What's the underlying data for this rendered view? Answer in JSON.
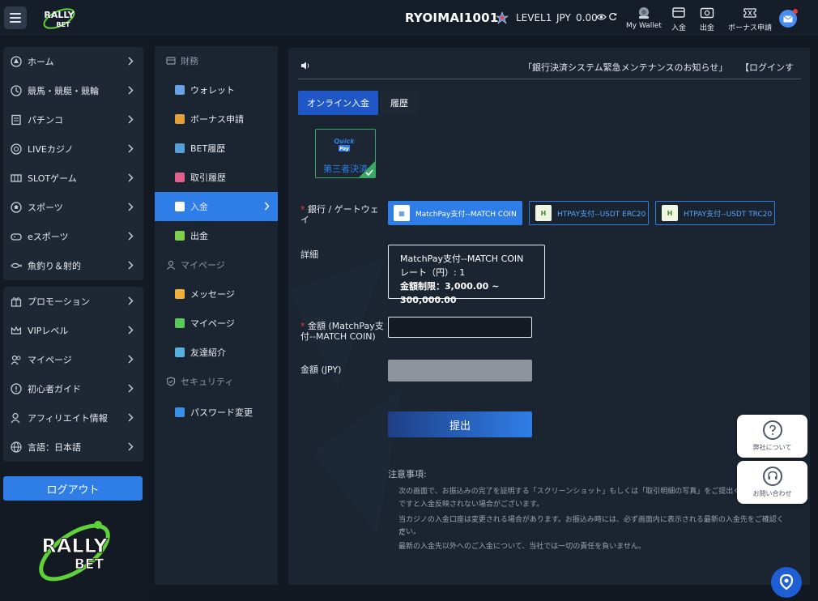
{
  "header": {
    "username": "RYOIMAI1001",
    "level": "LEVEL1",
    "currency": "JPY",
    "balance": "0.00",
    "buttons": [
      {
        "label": "My Wallet",
        "icon": "wallet-icon"
      },
      {
        "label": "入金",
        "icon": "deposit-icon"
      },
      {
        "label": "出金",
        "icon": "withdraw-icon"
      },
      {
        "label": "ボーナス申請",
        "icon": "bonus-ticket-icon"
      }
    ]
  },
  "sidebar": {
    "group1": [
      {
        "label": "ホーム",
        "icon": "home-icon"
      },
      {
        "label": "競馬・競艇・競輪",
        "icon": "race-icon"
      },
      {
        "label": "パチンコ",
        "icon": "pachinko-icon"
      },
      {
        "label": "LIVEカジノ",
        "icon": "live-casino-icon"
      },
      {
        "label": "SLOTゲーム",
        "icon": "slot-icon"
      },
      {
        "label": "スポーツ",
        "icon": "sports-icon"
      },
      {
        "label": "eスポーツ",
        "icon": "esports-icon"
      },
      {
        "label": "魚釣り＆射的",
        "icon": "fishing-icon"
      }
    ],
    "group2": [
      {
        "label": "プロモーション",
        "icon": "gift-icon"
      },
      {
        "label": "VIPレベル",
        "icon": "crown-icon"
      },
      {
        "label": "マイページ",
        "icon": "users-icon"
      },
      {
        "label": "初心者ガイド",
        "icon": "info-icon"
      },
      {
        "label": "アフィリエイト情報",
        "icon": "affiliate-icon"
      },
      {
        "label": "言語：日本語",
        "icon": "globe-icon"
      }
    ],
    "logout_label": "ログアウト"
  },
  "subnav": {
    "section_finance": "財務",
    "finance_items": [
      {
        "label": "ウォレット",
        "color": "#6aa0e6"
      },
      {
        "label": "ボーナス申請",
        "color": "#e3a13a"
      },
      {
        "label": "BET履歴",
        "color": "#55a0d8"
      },
      {
        "label": "取引履歴",
        "color": "#e35f8c"
      },
      {
        "label": "入金",
        "color": "#ffffff"
      },
      {
        "label": "出金",
        "color": "#7fcf4a"
      }
    ],
    "section_mypage": "マイページ",
    "mypage_items": [
      {
        "label": "メッセージ",
        "color": "#f0b23a"
      },
      {
        "label": "マイページ",
        "color": "#5cc85c"
      },
      {
        "label": "友達紹介",
        "color": "#58b0e0"
      }
    ],
    "section_security": "セキュリティ",
    "security_items": [
      {
        "label": "パスワード変更",
        "color": "#3a8fe8"
      }
    ]
  },
  "main": {
    "ticker_text": "「銀行決済システム緊急メンテナンスのお知らせ」",
    "ticker_text2": "【ログインす",
    "tabs": {
      "online": "オンライン入金",
      "history": "履歴"
    },
    "method": {
      "logo_text": "Quick Pay",
      "label": "第三者決済"
    },
    "gateway_label": "銀行 / ゲートウェイ",
    "gateways": [
      {
        "label": "MatchPay支付--MATCH COIN",
        "active": true
      },
      {
        "label": "HTPAY支付--USDT ERC20",
        "active": false
      },
      {
        "label": "HTPAY支付--USDT TRC20",
        "active": false
      }
    ],
    "detail_label": "詳細",
    "details": {
      "name": "MatchPay支付--MATCH COIN",
      "rate": "レート（円）: 1",
      "limit": "金額制限：3,000.00 ~ 300,000.00"
    },
    "amount_label_line1": "金額 (MatchPay支",
    "amount_label_line2": "付--MATCH COIN)",
    "amount_value": "",
    "jpy_label": "金額 (JPY)",
    "submit_label": "提出",
    "notes_title": "注意事項:",
    "notes": [
      "次の画面で、お振込みの完了を証明する「スクリーンショット」もしくは「取引明細の写真」をご提出くださ",
      "ですと入金反映されない場合がございます。",
      "当カジノの入金口座は変更される場合があります。お振込み時には、必ず画面内に表示される最新の入金先をご確認くだ",
      "さい。",
      "最新の入金先以外へのご入金について、当社では一切の責任を負いません。"
    ]
  },
  "widgets": {
    "about_label": "弊社について",
    "contact_label": "お問い合わせ"
  }
}
